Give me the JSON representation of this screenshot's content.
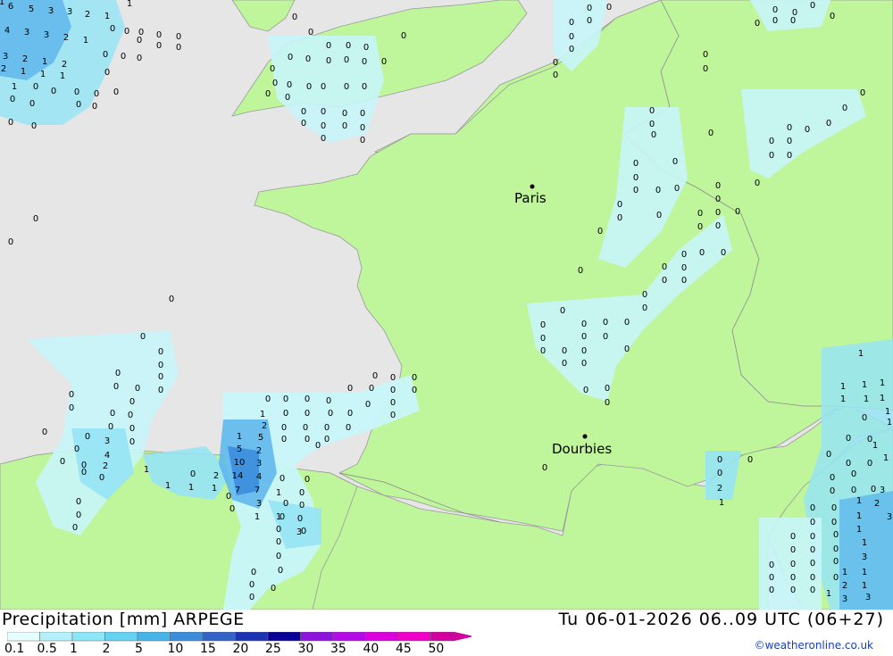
{
  "header": {
    "title": "Precipitation [mm] ARPEGE",
    "datetime": "Tu 06-01-2026 06..09 UTC (06+27)",
    "credit": "©weatheronline.co.uk"
  },
  "legend": {
    "labels": [
      "0.1",
      "0.5",
      "1",
      "2",
      "5",
      "10",
      "15",
      "20",
      "25",
      "30",
      "35",
      "40",
      "45",
      "50"
    ],
    "colors": [
      "#e6ffff",
      "#b4f0fa",
      "#8ce6f5",
      "#64d2f0",
      "#46b4e6",
      "#3c8cdc",
      "#3264c8",
      "#1e32b4",
      "#0a0096",
      "#8c14dc",
      "#b40ae6",
      "#dc00dc",
      "#f000c8",
      "#d200a0"
    ]
  },
  "map": {
    "colors": {
      "sea": "#e6e6e6",
      "land": "#bff59b",
      "border": "#9a9a9a",
      "precip_light": "#c8f5fa",
      "precip_mid": "#96e4f5",
      "precip_heavy": "#5ab4ec",
      "precip_core": "#3c8cdc"
    },
    "cities": [
      {
        "name": "Paris"
      },
      {
        "name": "Dourbies"
      }
    ],
    "values": [
      "6",
      "5",
      "3",
      "3",
      "2",
      "1",
      "4",
      "3",
      "3",
      "2",
      "1",
      "3",
      "2",
      "1",
      "2",
      "2",
      "1",
      "1",
      "1",
      "1",
      "0",
      "0",
      "0",
      "0",
      "0",
      "0",
      "0",
      "0",
      "0",
      "0",
      "0",
      "0",
      "0",
      "1",
      "1",
      "0",
      "0",
      "0",
      "0",
      "0",
      "0",
      "0",
      "0",
      "0",
      "0",
      "0",
      "0",
      "0",
      "0",
      "0",
      "0",
      "0",
      "0",
      "0",
      "0",
      "0",
      "0",
      "0",
      "0",
      "0",
      "0",
      "0",
      "0",
      "0",
      "0",
      "0",
      "0",
      "0",
      "0",
      "0",
      "0",
      "0",
      "0",
      "0",
      "0",
      "0",
      "0",
      "0",
      "0",
      "0",
      "0",
      "0",
      "0",
      "0",
      "0",
      "0",
      "0",
      "0",
      "0",
      "0",
      "0",
      "0",
      "0",
      "0",
      "0",
      "0",
      "0",
      "0",
      "0",
      "0",
      "0",
      "0",
      "0",
      "0",
      "0",
      "0",
      "0",
      "0",
      "0",
      "0",
      "0",
      "0",
      "0",
      "0",
      "0",
      "0",
      "0",
      "0",
      "0",
      "0",
      "0",
      "0",
      "0",
      "0",
      "0",
      "0",
      "0",
      "0",
      "0",
      "0",
      "0",
      "0",
      "0",
      "0",
      "1",
      "1",
      "1",
      "1",
      "1",
      "1",
      "1",
      "2",
      "1",
      "1",
      "1",
      "1",
      "1",
      "1",
      "1",
      "0",
      "3",
      "4",
      "2",
      "1",
      "5",
      "2",
      "10",
      "3",
      "2",
      "14",
      "4",
      "7",
      "7",
      "1",
      "1",
      "3",
      "2",
      "1",
      "1",
      "1",
      "2",
      "3",
      "3",
      "3",
      "1",
      "2",
      "2",
      "3",
      "2",
      "3",
      "1",
      "1",
      "1",
      "1"
    ]
  }
}
